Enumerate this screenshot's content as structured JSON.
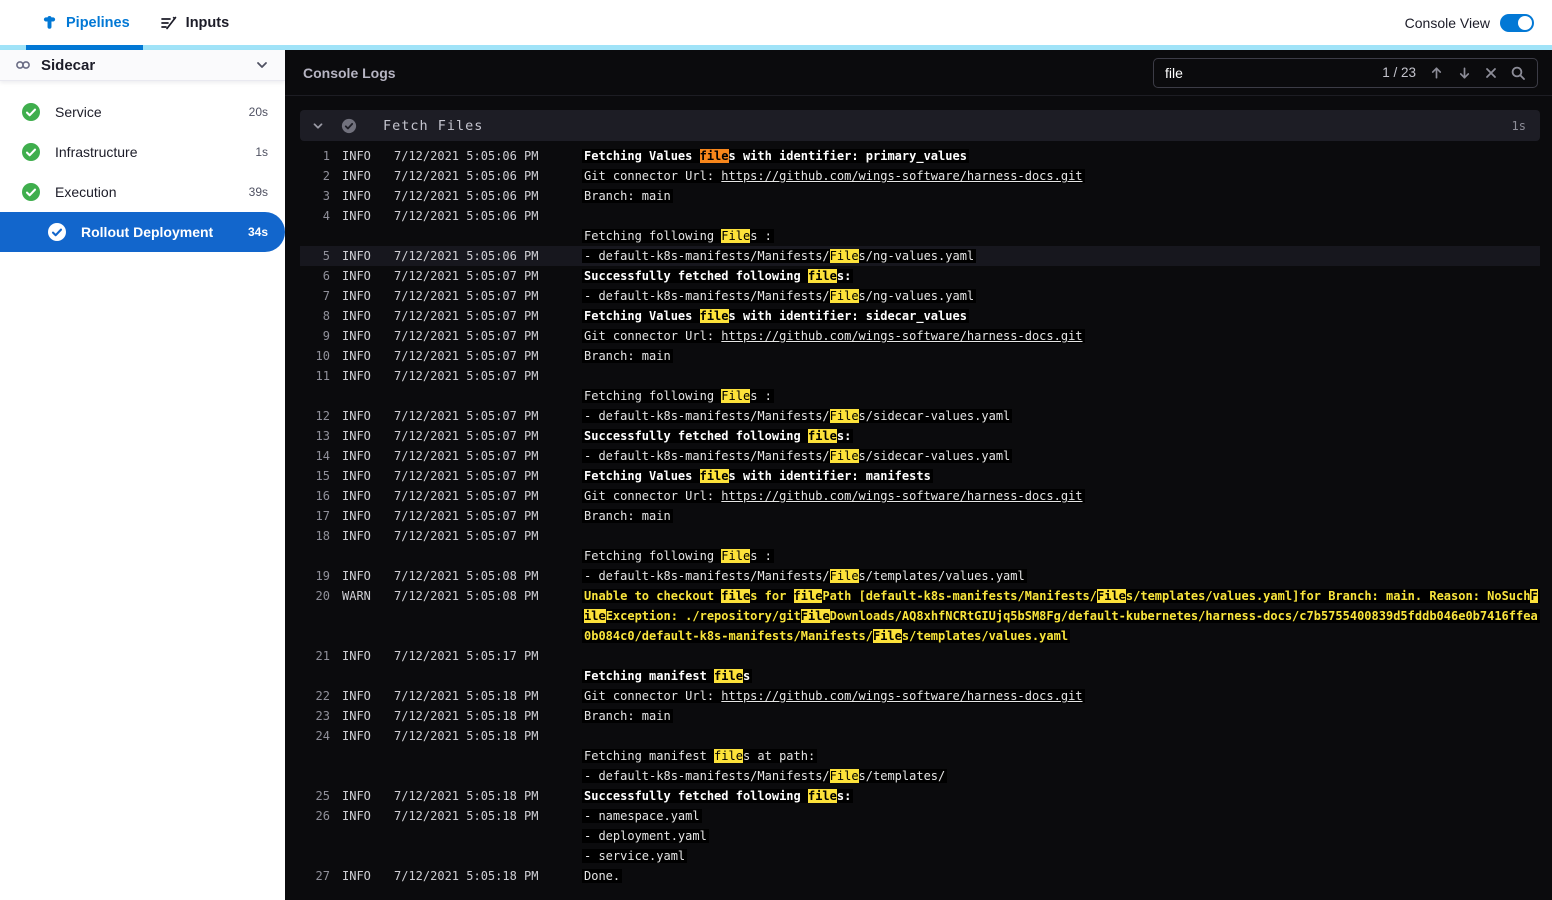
{
  "colors": {
    "accent": "#0278D5",
    "strip": "#a0e3f8",
    "selected": "#1266cc",
    "success": "#3fae4d",
    "match": "#fde23a",
    "match_current": "#f8861b",
    "warn": "#f9e53c"
  },
  "header": {
    "tabs": [
      {
        "label": "Pipelines",
        "icon": "pipelines-icon",
        "active": true
      },
      {
        "label": "Inputs",
        "icon": "inputs-icon",
        "active": false
      }
    ],
    "console_view_label": "Console View",
    "console_view_on": true
  },
  "sidebar": {
    "stage": {
      "label": "Sidecar",
      "icon": "link-icon"
    },
    "steps": [
      {
        "label": "Service",
        "duration": "20s",
        "status": "success"
      },
      {
        "label": "Infrastructure",
        "duration": "1s",
        "status": "success"
      },
      {
        "label": "Execution",
        "duration": "39s",
        "status": "success"
      },
      {
        "label": "Rollout Deployment",
        "duration": "34s",
        "status": "success",
        "selected": true,
        "indent": true
      }
    ]
  },
  "console": {
    "title": "Console Logs",
    "search": {
      "value": "file",
      "counter": "1 / 23"
    },
    "section": {
      "title": "Fetch Files",
      "duration": "1s"
    },
    "logs": [
      {
        "n": 1,
        "level": "INFO",
        "time": "7/12/2021 5:05:06 PM",
        "rows": [
          {
            "t": "Fetching Values files with identifier: primary_values",
            "b": true
          }
        ]
      },
      {
        "n": 2,
        "level": "INFO",
        "time": "7/12/2021 5:05:06 PM",
        "rows": [
          {
            "t": "Git connector Url: https://github.com/wings-software/harness-docs.git"
          }
        ]
      },
      {
        "n": 3,
        "level": "INFO",
        "time": "7/12/2021 5:05:06 PM",
        "rows": [
          {
            "t": "Branch: main"
          }
        ]
      },
      {
        "n": 4,
        "level": "INFO",
        "time": "7/12/2021 5:05:06 PM",
        "rows": [
          {
            "t": ""
          },
          {
            "t": "Fetching following Files :"
          }
        ]
      },
      {
        "n": 5,
        "level": "INFO",
        "time": "7/12/2021 5:05:06 PM",
        "sel": true,
        "rows": [
          {
            "t": "- default-k8s-manifests/Manifests/Files/ng-values.yaml"
          }
        ]
      },
      {
        "n": 6,
        "level": "INFO",
        "time": "7/12/2021 5:05:07 PM",
        "rows": [
          {
            "t": "Successfully fetched following files:",
            "b": true
          }
        ]
      },
      {
        "n": 7,
        "level": "INFO",
        "time": "7/12/2021 5:05:07 PM",
        "rows": [
          {
            "t": "- default-k8s-manifests/Manifests/Files/ng-values.yaml"
          }
        ]
      },
      {
        "n": 8,
        "level": "INFO",
        "time": "7/12/2021 5:05:07 PM",
        "rows": [
          {
            "t": "Fetching Values files with identifier: sidecar_values",
            "b": true
          }
        ]
      },
      {
        "n": 9,
        "level": "INFO",
        "time": "7/12/2021 5:05:07 PM",
        "rows": [
          {
            "t": "Git connector Url: https://github.com/wings-software/harness-docs.git"
          }
        ]
      },
      {
        "n": 10,
        "level": "INFO",
        "time": "7/12/2021 5:05:07 PM",
        "rows": [
          {
            "t": "Branch: main"
          }
        ]
      },
      {
        "n": 11,
        "level": "INFO",
        "time": "7/12/2021 5:05:07 PM",
        "rows": [
          {
            "t": ""
          },
          {
            "t": "Fetching following Files :"
          }
        ]
      },
      {
        "n": 12,
        "level": "INFO",
        "time": "7/12/2021 5:05:07 PM",
        "rows": [
          {
            "t": "- default-k8s-manifests/Manifests/Files/sidecar-values.yaml"
          }
        ]
      },
      {
        "n": 13,
        "level": "INFO",
        "time": "7/12/2021 5:05:07 PM",
        "rows": [
          {
            "t": "Successfully fetched following files:",
            "b": true
          }
        ]
      },
      {
        "n": 14,
        "level": "INFO",
        "time": "7/12/2021 5:05:07 PM",
        "rows": [
          {
            "t": "- default-k8s-manifests/Manifests/Files/sidecar-values.yaml"
          }
        ]
      },
      {
        "n": 15,
        "level": "INFO",
        "time": "7/12/2021 5:05:07 PM",
        "rows": [
          {
            "t": "Fetching Values files with identifier: manifests",
            "b": true
          }
        ]
      },
      {
        "n": 16,
        "level": "INFO",
        "time": "7/12/2021 5:05:07 PM",
        "rows": [
          {
            "t": "Git connector Url: https://github.com/wings-software/harness-docs.git"
          }
        ]
      },
      {
        "n": 17,
        "level": "INFO",
        "time": "7/12/2021 5:05:07 PM",
        "rows": [
          {
            "t": "Branch: main"
          }
        ]
      },
      {
        "n": 18,
        "level": "INFO",
        "time": "7/12/2021 5:05:07 PM",
        "rows": [
          {
            "t": ""
          },
          {
            "t": "Fetching following Files :"
          }
        ]
      },
      {
        "n": 19,
        "level": "INFO",
        "time": "7/12/2021 5:05:08 PM",
        "rows": [
          {
            "t": "- default-k8s-manifests/Manifests/Files/templates/values.yaml"
          }
        ]
      },
      {
        "n": 20,
        "level": "WARN",
        "time": "7/12/2021 5:05:08 PM",
        "rows": [
          {
            "t": "Unable to checkout files for filePath [default-k8s-manifests/Manifests/Files/templates/values.yaml]for Branch: main. Reason: NoSuchF",
            "b": true,
            "carry": 1
          },
          {
            "t": "ileException: ./repository/gitFileDownloads/AQ8xhfNCRtGIUjq5bSM8Fg/default-kubernetes/harness-docs/c7b5755400839d5fddb046e0b7416ffea",
            "b": true,
            "lead": 3
          },
          {
            "t": "0b084c0/default-k8s-manifests/Manifests/Files/templates/values.yaml",
            "b": true
          }
        ]
      },
      {
        "n": 21,
        "level": "INFO",
        "time": "7/12/2021 5:05:17 PM",
        "rows": [
          {
            "t": ""
          },
          {
            "t": "Fetching manifest files",
            "b": true
          }
        ]
      },
      {
        "n": 22,
        "level": "INFO",
        "time": "7/12/2021 5:05:18 PM",
        "rows": [
          {
            "t": "Git connector Url: https://github.com/wings-software/harness-docs.git"
          }
        ]
      },
      {
        "n": 23,
        "level": "INFO",
        "time": "7/12/2021 5:05:18 PM",
        "rows": [
          {
            "t": "Branch: main"
          }
        ]
      },
      {
        "n": 24,
        "level": "INFO",
        "time": "7/12/2021 5:05:18 PM",
        "rows": [
          {
            "t": ""
          },
          {
            "t": "Fetching manifest files at path:"
          },
          {
            "t": "- default-k8s-manifests/Manifests/Files/templates/"
          }
        ]
      },
      {
        "n": 25,
        "level": "INFO",
        "time": "7/12/2021 5:05:18 PM",
        "rows": [
          {
            "t": "Successfully fetched following files:",
            "b": true
          }
        ]
      },
      {
        "n": 26,
        "level": "INFO",
        "time": "7/12/2021 5:05:18 PM",
        "rows": [
          {
            "t": "- namespace.yaml"
          },
          {
            "t": "- deployment.yaml"
          },
          {
            "t": "- service.yaml"
          }
        ]
      },
      {
        "n": 27,
        "level": "INFO",
        "time": "7/12/2021 5:05:18 PM",
        "rows": [
          {
            "t": "Done."
          }
        ]
      }
    ]
  }
}
